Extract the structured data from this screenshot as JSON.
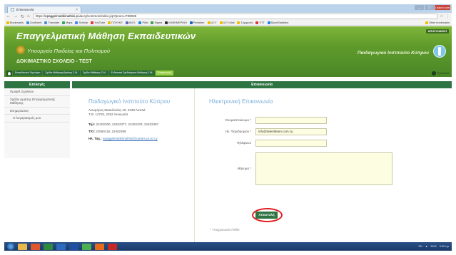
{
  "browser": {
    "tab_title": "Επικοινωνία",
    "tab_close": "×",
    "window_controls": [
      "—",
      "❐",
      "Lisbon xom"
    ],
    "url_prefix": "https://",
    "url_host": "epaggelmatikimathisi.pi.ac.cy",
    "url_path": "/common/index.jsp?pnum=P38038",
    "bookmarks": [
      {
        "label": "Bookmarks",
        "color": "#f0c000"
      },
      {
        "label": "ZooBomb",
        "color": "#4a90d9"
      },
      {
        "label": "Translate",
        "color": "#4a90d9"
      },
      {
        "label": "Maps",
        "color": "#34a853"
      },
      {
        "label": "Scholar",
        "color": "#4285f4"
      },
      {
        "label": "YouTube",
        "color": "#e53935"
      },
      {
        "label": "ΠΟΛΥΚΕ",
        "color": "#f0c000"
      },
      {
        "label": "ANTL",
        "color": "#5c6bc0"
      },
      {
        "label": "Pillai",
        "color": "#1e88e5"
      },
      {
        "label": "Sigma",
        "color": "#43a047"
      },
      {
        "label": "ΚΑΘΗΜΕΡΙΝΗ",
        "color": "#333333"
      },
      {
        "label": "Pedalizer",
        "color": "#1565c0"
      },
      {
        "label": "UCY",
        "color": "#f0c000"
      },
      {
        "label": "UCY-Mail",
        "color": "#f0c000"
      },
      {
        "label": "Συμφωνία",
        "color": "#f0c000"
      },
      {
        "label": "VTT",
        "color": "#e53935"
      },
      {
        "label": "SynolStatistics",
        "color": "#1e88e5"
      }
    ],
    "other_bookmarks": "Other bookmarks"
  },
  "site": {
    "title": "Επαγγελματική Μάθηση Εκπαιδευτικών",
    "ministry": "Υπουργείο Παιδείας και Πολιτισμού",
    "school": "ΔΟΚΙΜΑΣΤΙΚΟ ΣΧΟΛΕΙΟ - TEST",
    "pi_label": "Παιδαγωγικό Ινστιτούτο Κύπρου",
    "logout": "ΑΠΟΣΥΝΔΕΣΗ",
    "user": "Ppschool"
  },
  "menu": [
    {
      "label": "Εκπαιδευτικό Σεμινάριο",
      "active": false
    },
    {
      "label": "Σχέδια Μάθησης/Δράσης Σ.Μ.",
      "active": false
    },
    {
      "label": "Σχέδιο Μάθησης Σ.Μ.",
      "active": false
    },
    {
      "label": "Ενδεικτικά Σχεδιάσματα Μάθησης Σ.Μ.",
      "active": false
    },
    {
      "label": "Επικοινωνία",
      "active": true
    }
  ],
  "sidebar": {
    "heading": "Επιλογές",
    "items": [
      {
        "label": "Προφίλ Σχολείου",
        "indent": false
      },
      {
        "label": "Σχέδιο Δράσης Επαγγελματικής Μάθησης",
        "indent": false
      },
      {
        "label": "Ενημερώσεις",
        "indent": false
      },
      {
        "label": "Ο λογαριασμός μου",
        "indent": true
      }
    ]
  },
  "main": {
    "heading": "Επικοινωνία",
    "contact": {
      "name": "Παιδαγωγικό Ινστιτούτο Κύπρου",
      "address_line1": "Λεωφόρος Μακεδονίας 40, 2238 Λατσιά",
      "address_line2": "Τ.Θ. 12720, 2252 Λευκωσία",
      "phone_label": "Τηλ:",
      "phone_value": "22402300, 22402377, 22402378, 22402387",
      "fax_label": "Τ/Ο:",
      "fax_value": "22560118, 22402398",
      "email_label": "Ηλ. Ταχ.:",
      "email_value": "epaggelmatikimathisi@cyearn.pi.ac.cy"
    },
    "form": {
      "title": "Ηλεκτρονική Επικοινωνία",
      "name_label": "Ονοματεπώνυμο",
      "name_value": "",
      "email_label": "Ηλ. Ταχυδρομείο",
      "email_value": "info@talentteam.com.cy",
      "phone_label": "Τηλέφωνο",
      "phone_value": "",
      "message_label": "Μήνυμα",
      "message_value": "",
      "required_mark": "*",
      "submit": "Αποστολή",
      "required_note": "* Υποχρεωτικό Πεδίο"
    }
  },
  "taskbar": {
    "tray": [
      "EN",
      "▲",
      "ENG",
      "9:30 πμ"
    ]
  }
}
